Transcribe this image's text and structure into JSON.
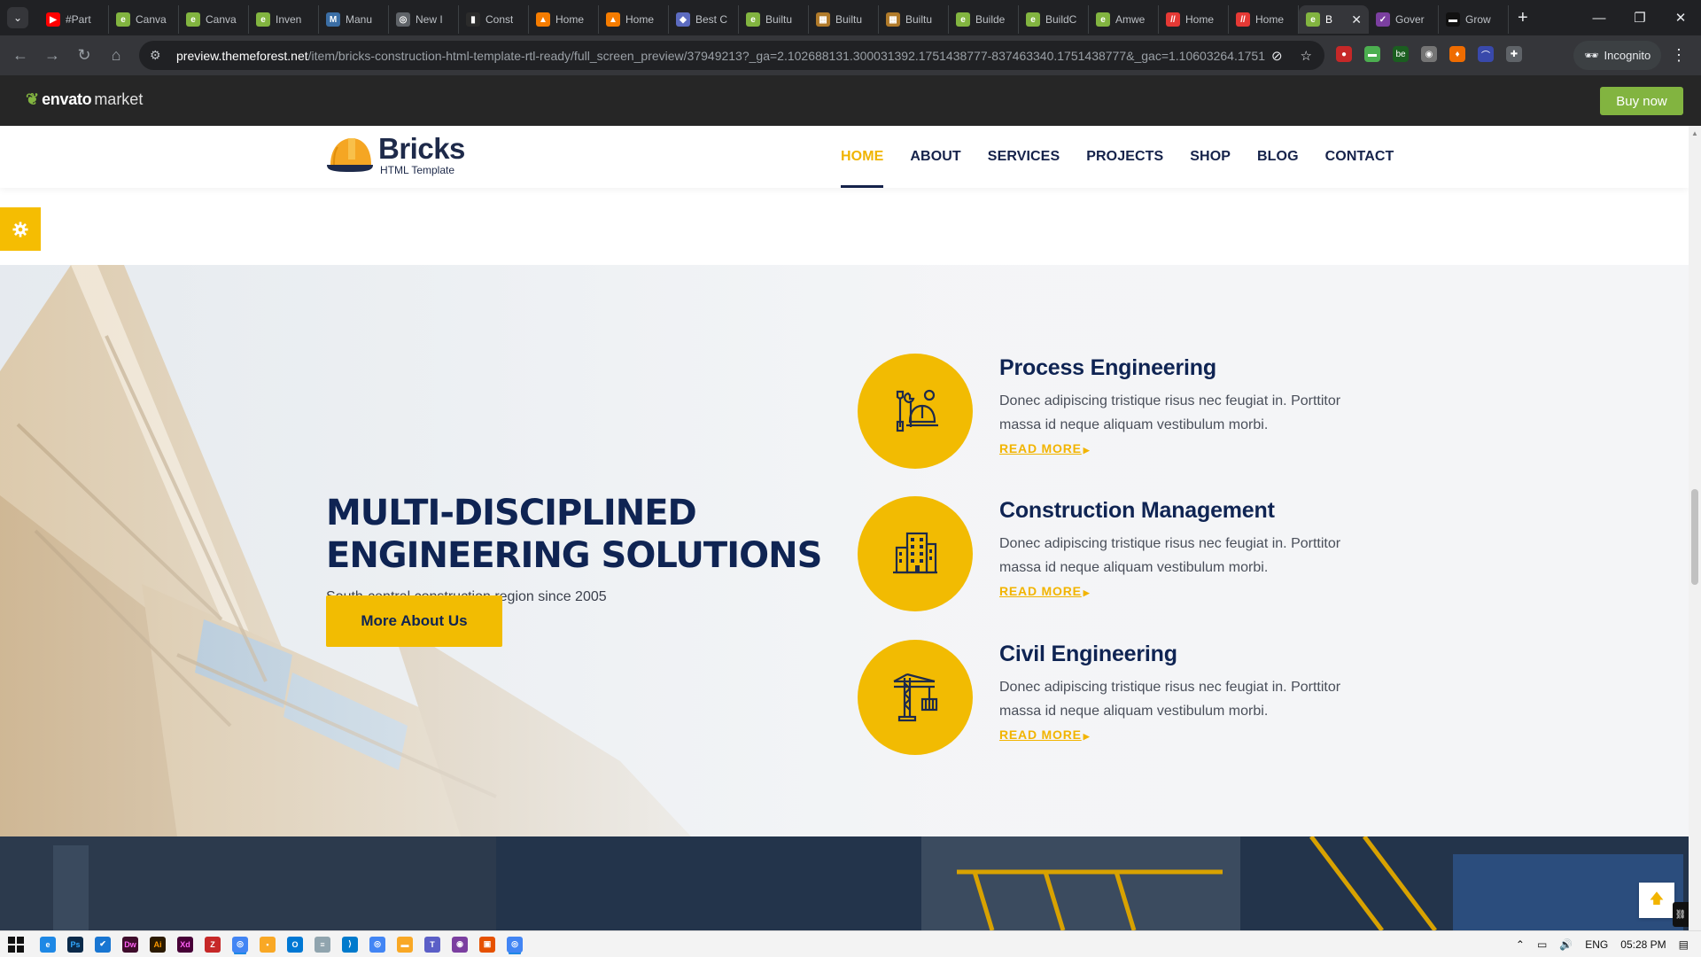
{
  "browser": {
    "tabs": [
      {
        "label": "#Part",
        "color": "#ff0000",
        "glyph": "▶"
      },
      {
        "label": "Canva",
        "color": "#82b440",
        "glyph": "e"
      },
      {
        "label": "Canva",
        "color": "#82b440",
        "glyph": "e"
      },
      {
        "label": "Inven",
        "color": "#82b440",
        "glyph": "e"
      },
      {
        "label": "Manu",
        "color": "#3b6ea5",
        "glyph": "M"
      },
      {
        "label": "New I",
        "color": "#5f6368",
        "glyph": "◎"
      },
      {
        "label": "Const",
        "color": "#2b2b2b",
        "glyph": "▮"
      },
      {
        "label": "Home",
        "color": "#f57c00",
        "glyph": "▲"
      },
      {
        "label": "Home",
        "color": "#f57c00",
        "glyph": "▲"
      },
      {
        "label": "Best C",
        "color": "#5c6bc0",
        "glyph": "◆"
      },
      {
        "label": "Builtu",
        "color": "#82b440",
        "glyph": "e"
      },
      {
        "label": "Builtu",
        "color": "#b07a2a",
        "glyph": "▦"
      },
      {
        "label": "Builtu",
        "color": "#b07a2a",
        "glyph": "▦"
      },
      {
        "label": "Builde",
        "color": "#82b440",
        "glyph": "e"
      },
      {
        "label": "BuildC",
        "color": "#82b440",
        "glyph": "e"
      },
      {
        "label": "Amwe",
        "color": "#82b440",
        "glyph": "e"
      },
      {
        "label": "Home",
        "color": "#e53935",
        "glyph": "//"
      },
      {
        "label": "Home",
        "color": "#e53935",
        "glyph": "//"
      },
      {
        "label": "B",
        "color": "#82b440",
        "glyph": "e",
        "active": true
      },
      {
        "label": "Gover",
        "color": "#7b3fa0",
        "glyph": "✓"
      },
      {
        "label": "Grow",
        "color": "#111111",
        "glyph": "▬"
      }
    ],
    "url_host": "preview.themeforest.net",
    "url_path": "/item/bricks-construction-html-template-rtl-ready/full_screen_preview/37949213?_ga=2.102688131.300031392.1751438777-837463340.1751438777&_gac=1.10603264.1751...",
    "incognito_label": "Incognito"
  },
  "envato": {
    "logo_bold": "envato",
    "logo_light": "market",
    "buy_now": "Buy now"
  },
  "site": {
    "brand_name": "Bricks",
    "brand_sub": "HTML Template",
    "nav": [
      "HOME",
      "ABOUT",
      "SERVICES",
      "PROJECTS",
      "SHOP",
      "BLOG",
      "CONTACT"
    ],
    "active_nav": "HOME"
  },
  "hero": {
    "heading_line1": "MULTI-DISCIPLINED",
    "heading_line2": "ENGINEERING SOLUTIONS",
    "subtitle": "South-central construction region since 2005",
    "button": "More About Us"
  },
  "services": [
    {
      "title": "Process Engineering",
      "desc": "Donec adipiscing tristique risus nec feugiat in. Porttitor massa id neque aliquam vestibulum morbi.",
      "link": "READ MORE",
      "icon": "engineer-tools-icon"
    },
    {
      "title": "Construction Management",
      "desc": "Donec adipiscing tristique risus nec feugiat in. Porttitor massa id neque aliquam vestibulum morbi.",
      "link": "READ MORE",
      "icon": "building-icon"
    },
    {
      "title": "Civil Engineering",
      "desc": "Donec adipiscing tristique risus nec feugiat in. Porttitor massa id neque aliquam vestibulum morbi.",
      "link": "READ MORE",
      "icon": "crane-icon"
    }
  ],
  "taskbar": {
    "language": "ENG",
    "time": "05:28 PM"
  },
  "colors": {
    "accent": "#f2bb02",
    "navy": "#0f2453",
    "envato_green": "#82b440"
  }
}
